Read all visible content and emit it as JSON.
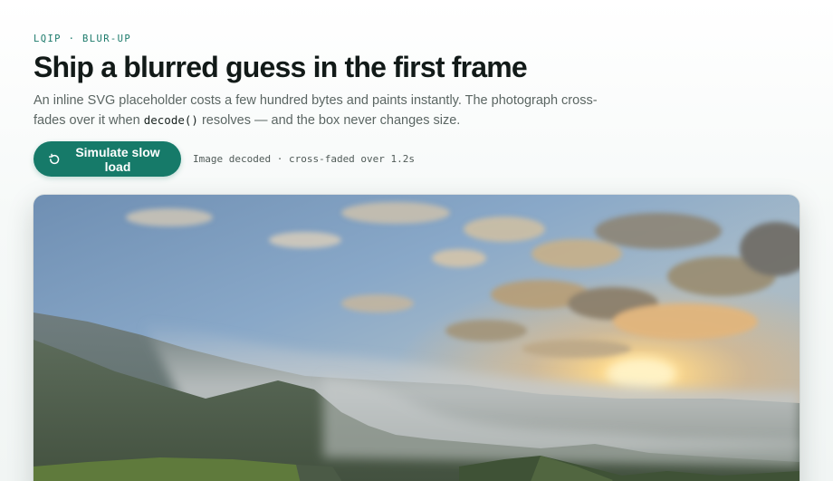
{
  "eyebrow": "LQIP · BLUR-UP",
  "title": "Ship a blurred guess in the first frame",
  "lede": {
    "before": "An inline SVG placeholder costs a few hundred bytes and paints instantly. The photograph cross-fades over it when ",
    "code": "decode()",
    "after": " resolves — and the box never changes size."
  },
  "button": {
    "label": "Simulate slow load",
    "icon": "reload-icon"
  },
  "status": "Image decoded · cross-faded over 1.2s",
  "photo": {
    "icon": "landscape-photo"
  },
  "colors": {
    "accent": "#167a69",
    "eyebrow": "#1c7a6b"
  }
}
